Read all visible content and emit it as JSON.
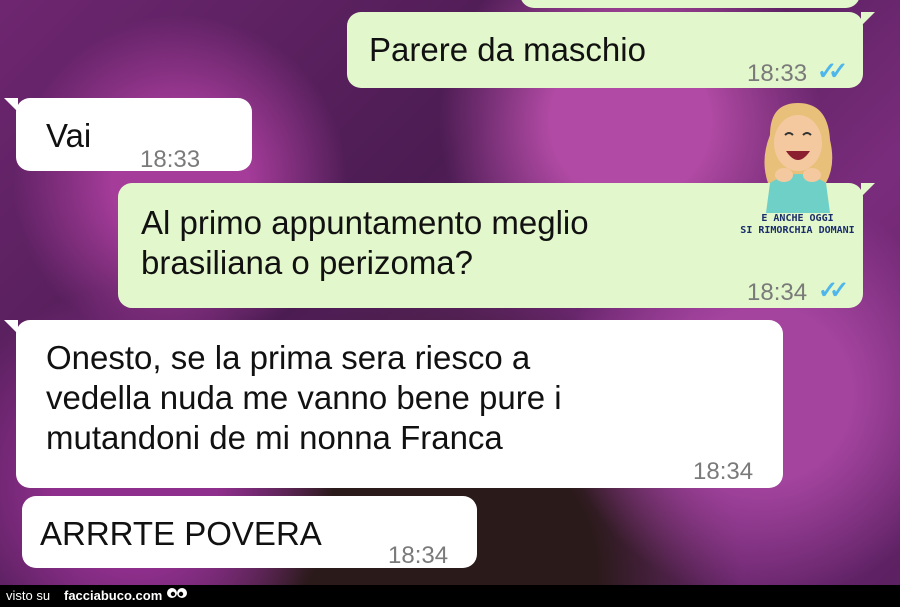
{
  "messages": [
    {
      "text": "Parere da maschio",
      "time": "18:33",
      "ticks": "✓✓"
    },
    {
      "text": "Vai",
      "time": "18:33"
    },
    {
      "text": "Al primo appuntamento meglio\nbrasiliana o perizoma?",
      "time": "18:34",
      "ticks": "✓✓"
    },
    {
      "text": "Onesto, se la prima sera riesco a\nvedella nuda me vanno bene pure i\nmutandoni de mi nonna Franca",
      "time": "18:34"
    },
    {
      "text": "ARRRTE POVERA",
      "time": "18:34"
    }
  ],
  "sticker": {
    "caption": "E ANCHE OGGI\nSI RIMORCHIA DOMANI"
  },
  "footer": {
    "visto_su": "visto su",
    "site": "facciabuco.com"
  },
  "colors": {
    "outgoing": "#e2f7cb",
    "incoming": "#ffffff",
    "ticks": "#4fb6ec"
  }
}
